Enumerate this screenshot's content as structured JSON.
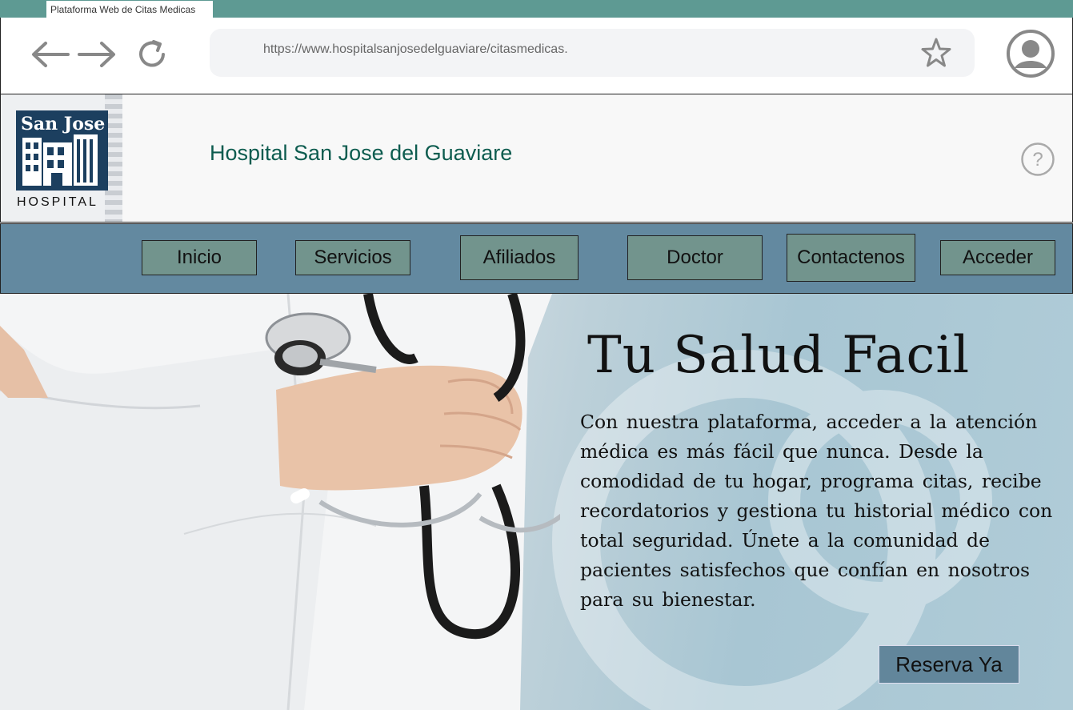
{
  "browser": {
    "tab_title": "Plataforma Web de Citas Medicas",
    "url": "https://www.hospitalsanjosedelguaviare/citasmedicas.",
    "icons": [
      "back-arrow-icon",
      "forward-arrow-icon",
      "reload-icon",
      "star-icon",
      "user-avatar-icon"
    ]
  },
  "header": {
    "logo_text": "San Jose",
    "logo_caption": "HOSPITAL",
    "site_title": "Hospital San Jose del Guaviare",
    "help_icon": "question-circle-icon"
  },
  "menu": {
    "items": [
      {
        "label": "Inicio"
      },
      {
        "label": "Servicios"
      },
      {
        "label": "Afiliados"
      },
      {
        "label": "Doctor"
      },
      {
        "label": "Contactenos"
      },
      {
        "label": "Acceder"
      }
    ]
  },
  "hero": {
    "title": "Tu Salud Facil",
    "paragraph": "Con nuestra plataforma, acceder a la atención médica es más fácil que nunca. Desde la comodidad de tu hogar, programa citas, recibe recordatorios y gestiona tu historial médico con total seguridad. Únete a la comunidad de pacientes satisfechos que confían en nosotros para su bienestar.",
    "cta_label": "Reserva Ya"
  },
  "colors": {
    "tabbar": "#5e9a93",
    "menubar": "#6389a0",
    "menu_button": "#72948d",
    "title_text": "#0d5c4f",
    "cta_button": "#62869b"
  }
}
